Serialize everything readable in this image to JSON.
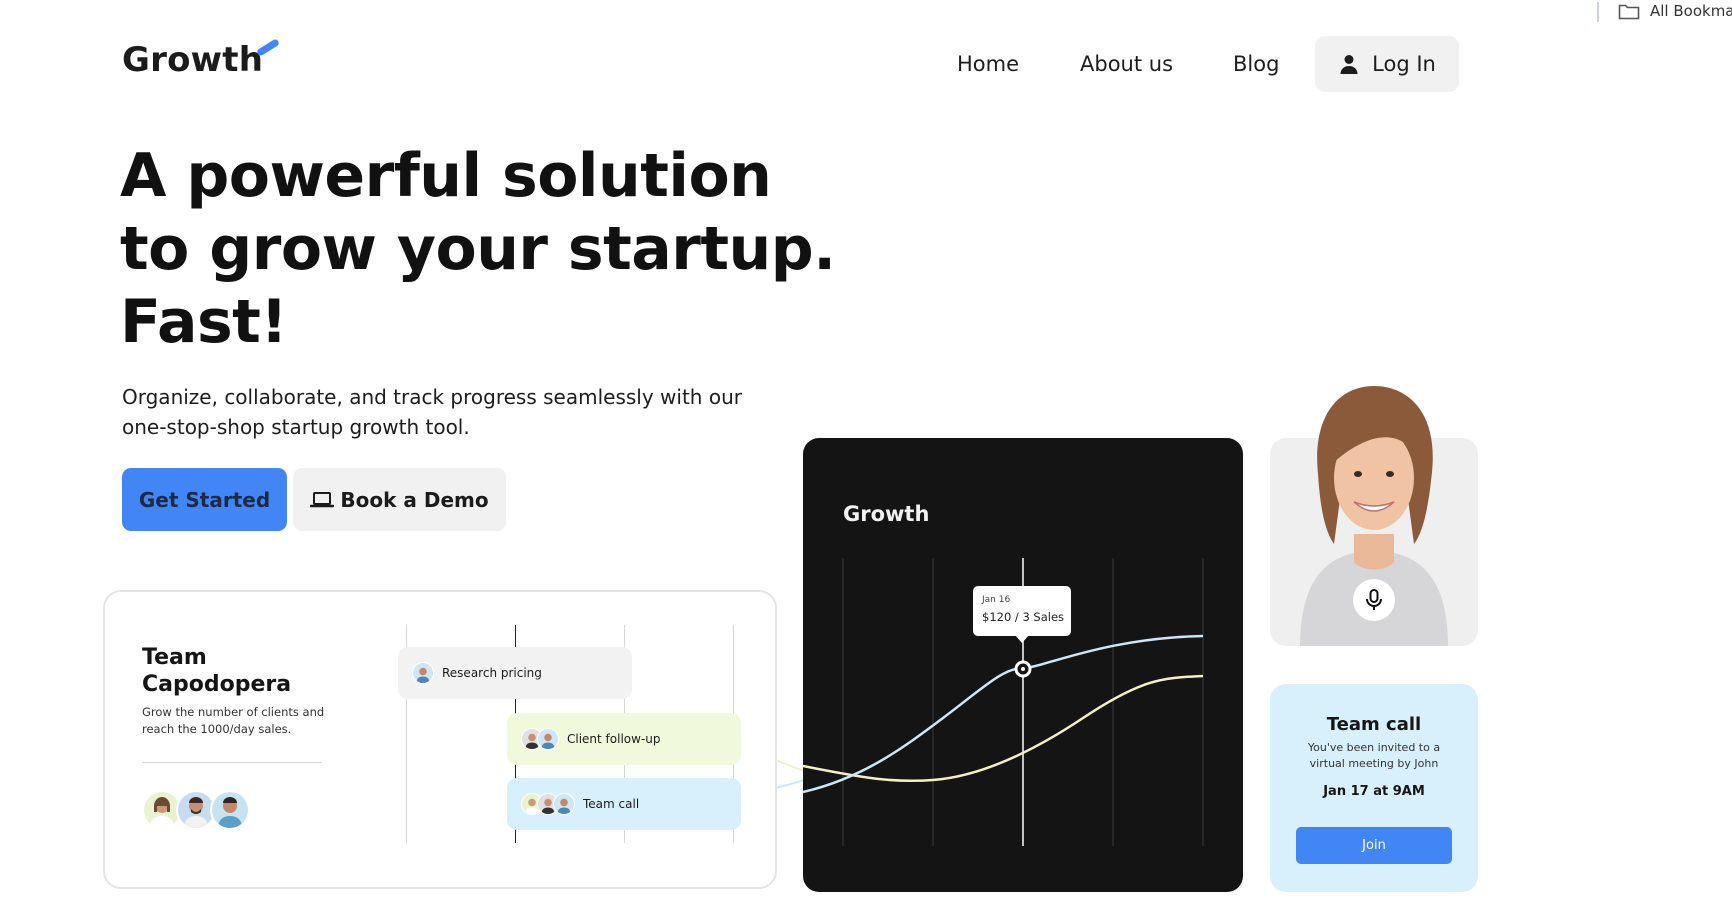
{
  "bookmarks_bar": {
    "all_bookmarks_label": "All Bookmark"
  },
  "header": {
    "logo": "Growth",
    "nav": {
      "home": "Home",
      "about": "About us",
      "blog": "Blog"
    },
    "login_label": "Log In"
  },
  "hero": {
    "title_line1": "A powerful solution",
    "title_line2": "to grow your startup.",
    "title_line3": "Fast!",
    "subtitle_line1": "Organize, collaborate, and track progress seamlessly with our",
    "subtitle_line2": "one-stop-shop startup growth tool.",
    "primary_cta": "Get Started",
    "secondary_cta": "Book a Demo"
  },
  "team_card": {
    "title_line1": "Team",
    "title_line2": "Capodopera",
    "description": "Grow the number of clients and reach the 1000/day sales.",
    "tasks": [
      {
        "label": "Research pricing"
      },
      {
        "label": "Client follow-up"
      },
      {
        "label": "Team call"
      }
    ]
  },
  "growth_card": {
    "title": "Growth",
    "tooltip_date": "Jan 16",
    "tooltip_value": "$120 / 3 Sales"
  },
  "call_card": {
    "title": "Team call",
    "description": "You've been invited to a virtual meeting by John",
    "time": "Jan 17 at 9AM",
    "join_label": "Join"
  },
  "colors": {
    "accent": "#4285f4",
    "dark_card": "#141414",
    "call_card_bg": "#d8f0fb",
    "task_green": "#f0f9db",
    "line_blue": "#cfe6f8",
    "line_cream": "#f3f0c8"
  },
  "icons": {
    "folder": "folder-icon",
    "user": "user-icon",
    "laptop": "laptop-icon",
    "mic": "microphone-icon"
  }
}
